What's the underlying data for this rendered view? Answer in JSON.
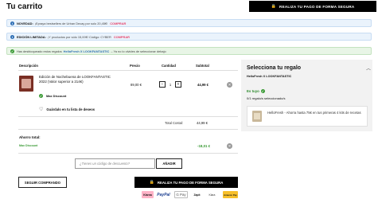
{
  "header": {
    "title": "Tu carrito",
    "pay_button": "REALIZA TU PAGO DE FORMA SEGURA"
  },
  "banners": [
    {
      "label": "NOVEDAD:",
      "text": "¡Epraya bestsellers de Urban Decay por solo 20,45€!",
      "link": "COMPRAR"
    },
    {
      "label": "EDICIÓN LIMITADA:",
      "text": "¡Y productos por sólo 15,00€! Código: CYBER",
      "link": "COMPRAR"
    },
    {
      "text": "Has desbloqueado estos regalos",
      "highlight": "HelloFresh X LOOKFANTASTIC",
      "rest": "– Ya no lo olvides de seleccionar debajo"
    }
  ],
  "table": {
    "headers": {
      "description": "Descripción",
      "price": "Precio",
      "quantity": "Cantidad",
      "subtotal": "Subtotal"
    },
    "item": {
      "name": "Edición de Nochebuena de LOOKFANTASTIC 2022 (Valor superior a 214€)",
      "badge": "Max Discount",
      "wishlist": "Guárdalo en tu lista de deseos",
      "price": "89,00 €",
      "quantity": "1",
      "subtotal": "44,99 €"
    },
    "total_label": "Total Costal:",
    "total_value": "44,99 €"
  },
  "savings": {
    "label": "Ahorro total:",
    "detail": "Max Discount",
    "value": "-18,01 €"
  },
  "coupon": {
    "placeholder": "¿Tienes un código de descuento?",
    "apply": "AÑADIR"
  },
  "actions": {
    "continue": "SEGUIR COMPRANDO",
    "pay": "REALIZA TU PAGO DE FORMA SEGURA"
  },
  "payment_methods": [
    "Klarna",
    "PayPal",
    "G Pay",
    "Zapit",
    "Klara",
    "Amazon Pay"
  ],
  "gift": {
    "title": "Selecciona tu regalo",
    "subtitle": "HelloFresh X LOOKFANTASTIC",
    "free": "Es tuyo",
    "count": "0/1 regalo/s seleccionado/s",
    "description": "HelloFresh - Ahorra hasta 75€ en tus primeras 4 kits de recetas"
  },
  "colors": {
    "accent": "#e8436a",
    "success": "#3a9a35",
    "primary": "#000000"
  }
}
